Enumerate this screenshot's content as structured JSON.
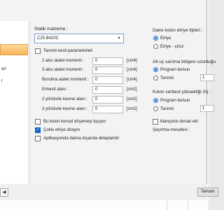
{
  "left_tree": {
    "items": [
      "eri",
      "r"
    ]
  },
  "material": {
    "label": "Statik malzeme :",
    "value": "C25 B420C"
  },
  "section": {
    "custom_label": "Tanımlı kesit parametreleri",
    "rows": [
      {
        "label": "2 aksı atalet momenti :",
        "value": "0",
        "unit": "[cm4]"
      },
      {
        "label": "3 aksı atalet momenti :",
        "value": "0",
        "unit": "[cm4]"
      },
      {
        "label": "Burulma atalet momenti :",
        "value": "0",
        "unit": "[cm4]"
      },
      {
        "label": "Enkesit alanı :",
        "value": "0",
        "unit": "[cm2]"
      },
      {
        "label": "2 yönünde kesme alanı :",
        "value": "0",
        "unit": "[cm2]"
      },
      {
        "label": "3 yönünde kesme alanı :",
        "value": "0",
        "unit": "[cm2]"
      }
    ]
  },
  "options": {
    "console": "Bu kolon konsol döşemeyi taşıyor",
    "multi_tie": "Çoklu etriye dizaynı",
    "always_outside": "Aplikasyonda daima dışarıda detaylandır"
  },
  "right": {
    "tie_type": {
      "label": "Daire kolon etriye tipleri :",
      "options": [
        "Etriye",
        "Etriye - çiroz"
      ],
      "selected": 0
    },
    "dense_zone": {
      "label": "Alt uç sarılma bölgesi uzunluğu",
      "options": [
        "Program bulsun",
        "Tanımlı"
      ],
      "selected": 0,
      "stepper_value": "1"
    },
    "free_height": {
      "label": "Kolon serbest yüksekliği (h) :",
      "options": [
        "Program bulsun",
        "Tanımlı"
      ],
      "selected": 0,
      "stepper_value": "1"
    },
    "manson": "Manşonlu donatı ekl",
    "shift_label": "Şaşırtma mesafesi :"
  },
  "footer": {
    "scroll_left": "◀",
    "button": "Tamam"
  }
}
